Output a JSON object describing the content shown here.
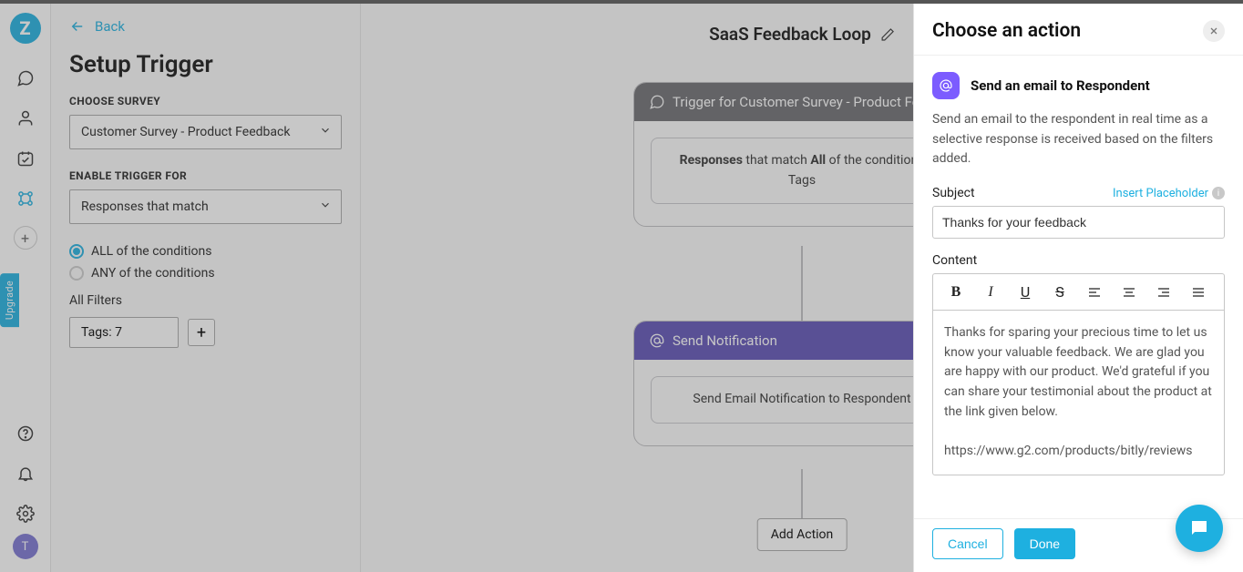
{
  "app": {
    "logo_letter": "Z",
    "upgrade_label": "Upgrade",
    "avatar_letter": "T"
  },
  "back_label": "Back",
  "setup_title": "Setup Trigger",
  "choose_survey_label": "CHOOSE SURVEY",
  "survey_select": "Customer Survey - Product Feedback",
  "enable_trigger_label": "ENABLE TRIGGER FOR",
  "trigger_select": "Responses that match",
  "radio_all": "ALL of the conditions",
  "radio_any": "ANY of the conditions",
  "all_filters_label": "All Filters",
  "tag_value": "Tags: 7",
  "canvas": {
    "title": "SaaS Feedback Loop",
    "trigger_header": "Trigger for Customer Survey - Product Feed",
    "trigger_body_a": "Responses",
    "trigger_body_b": " that match ",
    "trigger_body_c": "All",
    "trigger_body_d": " of the conditions",
    "trigger_tags": "Tags",
    "action_header": "Send Notification",
    "action_body": "Send Email Notification to Respondent",
    "add_action": "Add Action"
  },
  "drawer": {
    "title": "Choose an action",
    "action_name": "Send an email to Respondent",
    "description": "Send an email to the respondent in real time as a selective response is received based on the filters added.",
    "subject_label": "Subject",
    "insert_placeholder": "Insert Placeholder",
    "subject_value": "Thanks for your feedback",
    "content_label": "Content",
    "content_body": "Thanks for sparing your precious time to let us know your valuable feedback. We are glad you are happy with our product. We'd grateful if you can share your testimonial about the product at  the link given below.\n\nhttps://www.g2.com/products/bitly/reviews",
    "cancel": "Cancel",
    "done": "Done"
  },
  "toolbar": {
    "bold": "B",
    "italic": "I",
    "under": "U",
    "strike": "S"
  }
}
